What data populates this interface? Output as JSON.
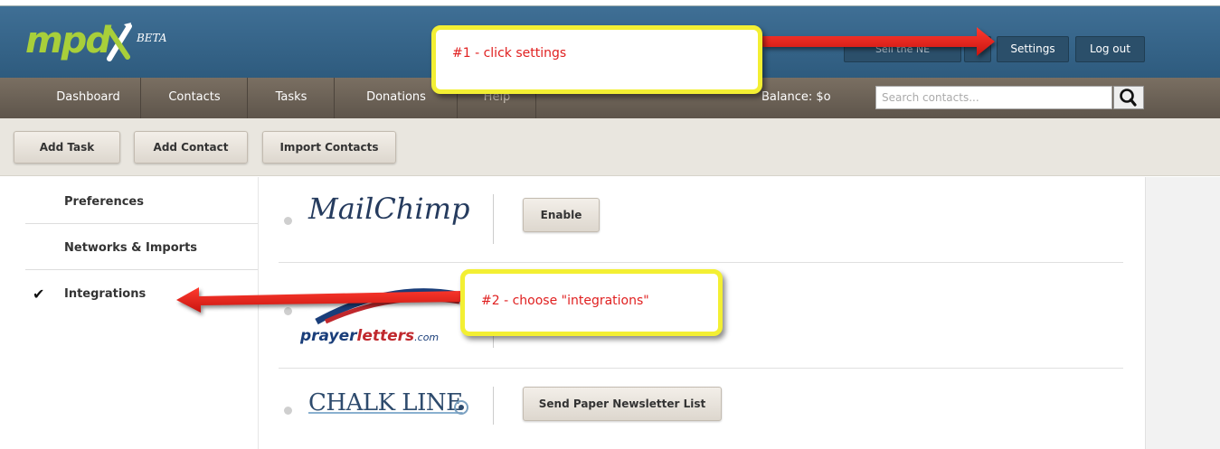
{
  "header": {
    "logo_text": "mpd",
    "logo_badge": "BETA",
    "user_menu_label": "Sell the NE",
    "settings_label": "Settings",
    "logout_label": "Log out"
  },
  "nav": {
    "items": [
      "Dashboard",
      "Contacts",
      "Tasks",
      "Donations",
      "Help"
    ],
    "balance": "Balance: $o",
    "search_placeholder": "Search contacts..."
  },
  "actions": {
    "add_task": "Add Task",
    "add_contact": "Add Contact",
    "import_contacts": "Import Contacts"
  },
  "sidebar": {
    "items": [
      {
        "label": "Preferences",
        "checked": false
      },
      {
        "label": "Networks & Imports",
        "checked": false
      },
      {
        "label": "Integrations",
        "checked": true
      }
    ],
    "check_glyph": "✔"
  },
  "integrations": {
    "mailchimp": {
      "logo": "MailChimp",
      "button": "Enable"
    },
    "prayerletters": {
      "logo_prefix": "prayer",
      "logo_accent": "letters",
      "logo_suffix": ".com"
    },
    "chalkline": {
      "logo": "CHALK LINE",
      "button": "Send Paper Newsletter List"
    }
  },
  "annotations": {
    "callout1": "#1 - click settings",
    "callout2": "#2 - choose \"integrations\""
  },
  "colors": {
    "topbar": "#3a6a8f",
    "navbar": "#6b6157",
    "logo_green": "#a8cf3a",
    "callout_border": "#f3ef33",
    "callout_text": "#e02020",
    "arrow": "#e3201b"
  }
}
